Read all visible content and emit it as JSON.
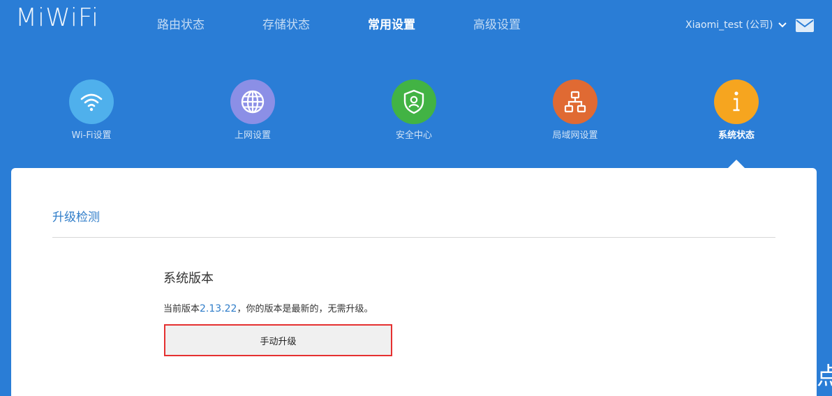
{
  "header": {
    "logo": "MiWiFi",
    "tabs": [
      {
        "label": "路由状态",
        "active": false
      },
      {
        "label": "存储状态",
        "active": false
      },
      {
        "label": "常用设置",
        "active": true
      },
      {
        "label": "高级设置",
        "active": false
      }
    ],
    "user_label": "Xiaomi_test (公司)",
    "user_icon": "chevron-down-icon",
    "mail_icon": "mail-icon"
  },
  "features": [
    {
      "label": "Wi-Fi设置",
      "icon": "wifi-icon",
      "color": "#4fb0ec",
      "active": false
    },
    {
      "label": "上网设置",
      "icon": "globe-icon",
      "color": "#8b8fe6",
      "active": false
    },
    {
      "label": "安全中心",
      "icon": "shield-icon",
      "color": "#42b344",
      "active": false
    },
    {
      "label": "局域网设置",
      "icon": "network-icon",
      "color": "#e06a33",
      "active": false
    },
    {
      "label": "系统状态",
      "icon": "info-icon",
      "color": "#f6a51f",
      "active": true
    }
  ],
  "content": {
    "section_title": "升级检测",
    "block_title": "系统版本",
    "version_prefix": "当前版本",
    "version": "2.13.22",
    "version_suffix": "，你的版本是最新的，无需升级。",
    "upgrade_button": "手动升级"
  },
  "edge_text": "点",
  "colors": {
    "background": "#2a7dd6",
    "accent": "#2f7dc9",
    "highlight_border": "#e53030"
  }
}
